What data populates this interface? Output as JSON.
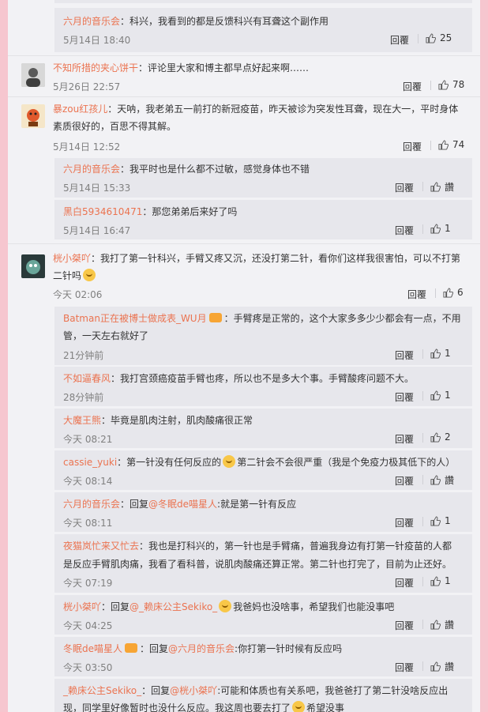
{
  "comments": [
    {
      "kind": "sub",
      "user": "六月的音乐会",
      "text": "：科兴，我看到的都是反馈科兴有耳聋这个副作用",
      "time": "5月14日 18:40",
      "reply": "回覆",
      "likes": "25"
    },
    {
      "kind": "main",
      "user": "不知所措的夹心饼干",
      "text": "：评论里大家和博主都早点好起来啊……",
      "time": "5月26日 22:57",
      "reply": "回覆",
      "likes": "78"
    },
    {
      "kind": "main",
      "user": "暴zou红孩儿",
      "text": "：天呐，我老弟五一前打的新冠疫苗，昨天被诊为突发性耳聋，现在大一，平时身体",
      "text2": "素质很好的，百思不得其解。",
      "time": "5月14日 12:52",
      "reply": "回覆",
      "likes": "74"
    },
    {
      "kind": "sub",
      "user": "六月的音乐会",
      "text": "：我平时也是什么都不过敏，感觉身体也不错",
      "time": "5月14日 15:33",
      "reply": "回覆",
      "likes": "讚"
    },
    {
      "kind": "sub",
      "user": "黑白5934610471",
      "text": "：那您弟弟后来好了吗",
      "time": "5月14日 16:47",
      "reply": "回覆",
      "likes": "1"
    },
    {
      "kind": "main",
      "user": "桄小桀吖",
      "text": "：我打了第一针科兴，手臂又疼又沉，还没打第二针，看你们这样我很害怕，可以不打第",
      "text2": "二针吗",
      "time": "今天 02:06",
      "reply": "回覆",
      "likes": "6"
    },
    {
      "kind": "sub",
      "user": "Batman正在被博士做成表_WU月",
      "text": "：手臂疼是正常的，这个大家多多少少都会有一点，不用",
      "text2": "管，一天左右就好了",
      "time": "21分钟前",
      "reply": "回覆",
      "likes": "1"
    },
    {
      "kind": "sub",
      "user": "不如逼春风",
      "text": "：我打宫颈癌疫苗手臂也疼，所以也不是多大个事。手臂酸疼问题不大。",
      "time": "28分钟前",
      "reply": "回覆",
      "likes": "1"
    },
    {
      "kind": "sub",
      "user": "大魔王熊",
      "text": "：毕竟是肌肉注射，肌肉酸痛很正常",
      "time": "今天 08:21",
      "reply": "回覆",
      "likes": "2"
    },
    {
      "kind": "sub",
      "user": "cassie_yuki",
      "text": "：第一针没有任何反应的",
      "text_b": "第二针会不会很严重（我是个免疫力极其低下的人）",
      "time": "今天 08:14",
      "reply": "回覆",
      "likes": "讚"
    },
    {
      "kind": "sub",
      "user": "六月的音乐会",
      "text": "：回复",
      "at": "@冬眠de喵星人",
      "text_b": ":就是第一针有反应",
      "time": "今天 08:11",
      "reply": "回覆",
      "likes": "1"
    },
    {
      "kind": "sub",
      "user": "夜猫岚忙来又忙去",
      "text": "：我也是打科兴的，第一针也是手臂痛，普遍我身边有打第一针疫苗的人都",
      "text2": "是反应手臂肌肉痛，我看了看科普，说肌肉酸痛还算正常。第二针也打完了，目前为止还好。",
      "time": "今天 07:19",
      "reply": "回覆",
      "likes": "1"
    },
    {
      "kind": "sub",
      "user": "桄小桀吖",
      "text": "：回复",
      "at": "@_赖床公主Sekiko_",
      "text_b": "我爸妈也没啥事，希望我们也能没事吧",
      "time": "今天 04:25",
      "reply": "回覆",
      "likes": "讚"
    },
    {
      "kind": "sub",
      "user": "冬眠de喵星人",
      "text": "：回复",
      "at": "@六月的音乐会",
      "text_b": ":你打第一针时候有反应吗",
      "time": "今天 03:50",
      "reply": "回覆",
      "likes": "讚"
    },
    {
      "kind": "sub",
      "user": "_赖床公主Sekiko_",
      "text": "：回复",
      "at": "@桄小桀吖",
      "text_b": ":可能和体质也有关系吧，我爸爸打了第二针没啥反应出",
      "text2": "现，同学里好像暂时也没什么反应。我这周也要去打了",
      "text2_b": "希望没事"
    }
  ]
}
